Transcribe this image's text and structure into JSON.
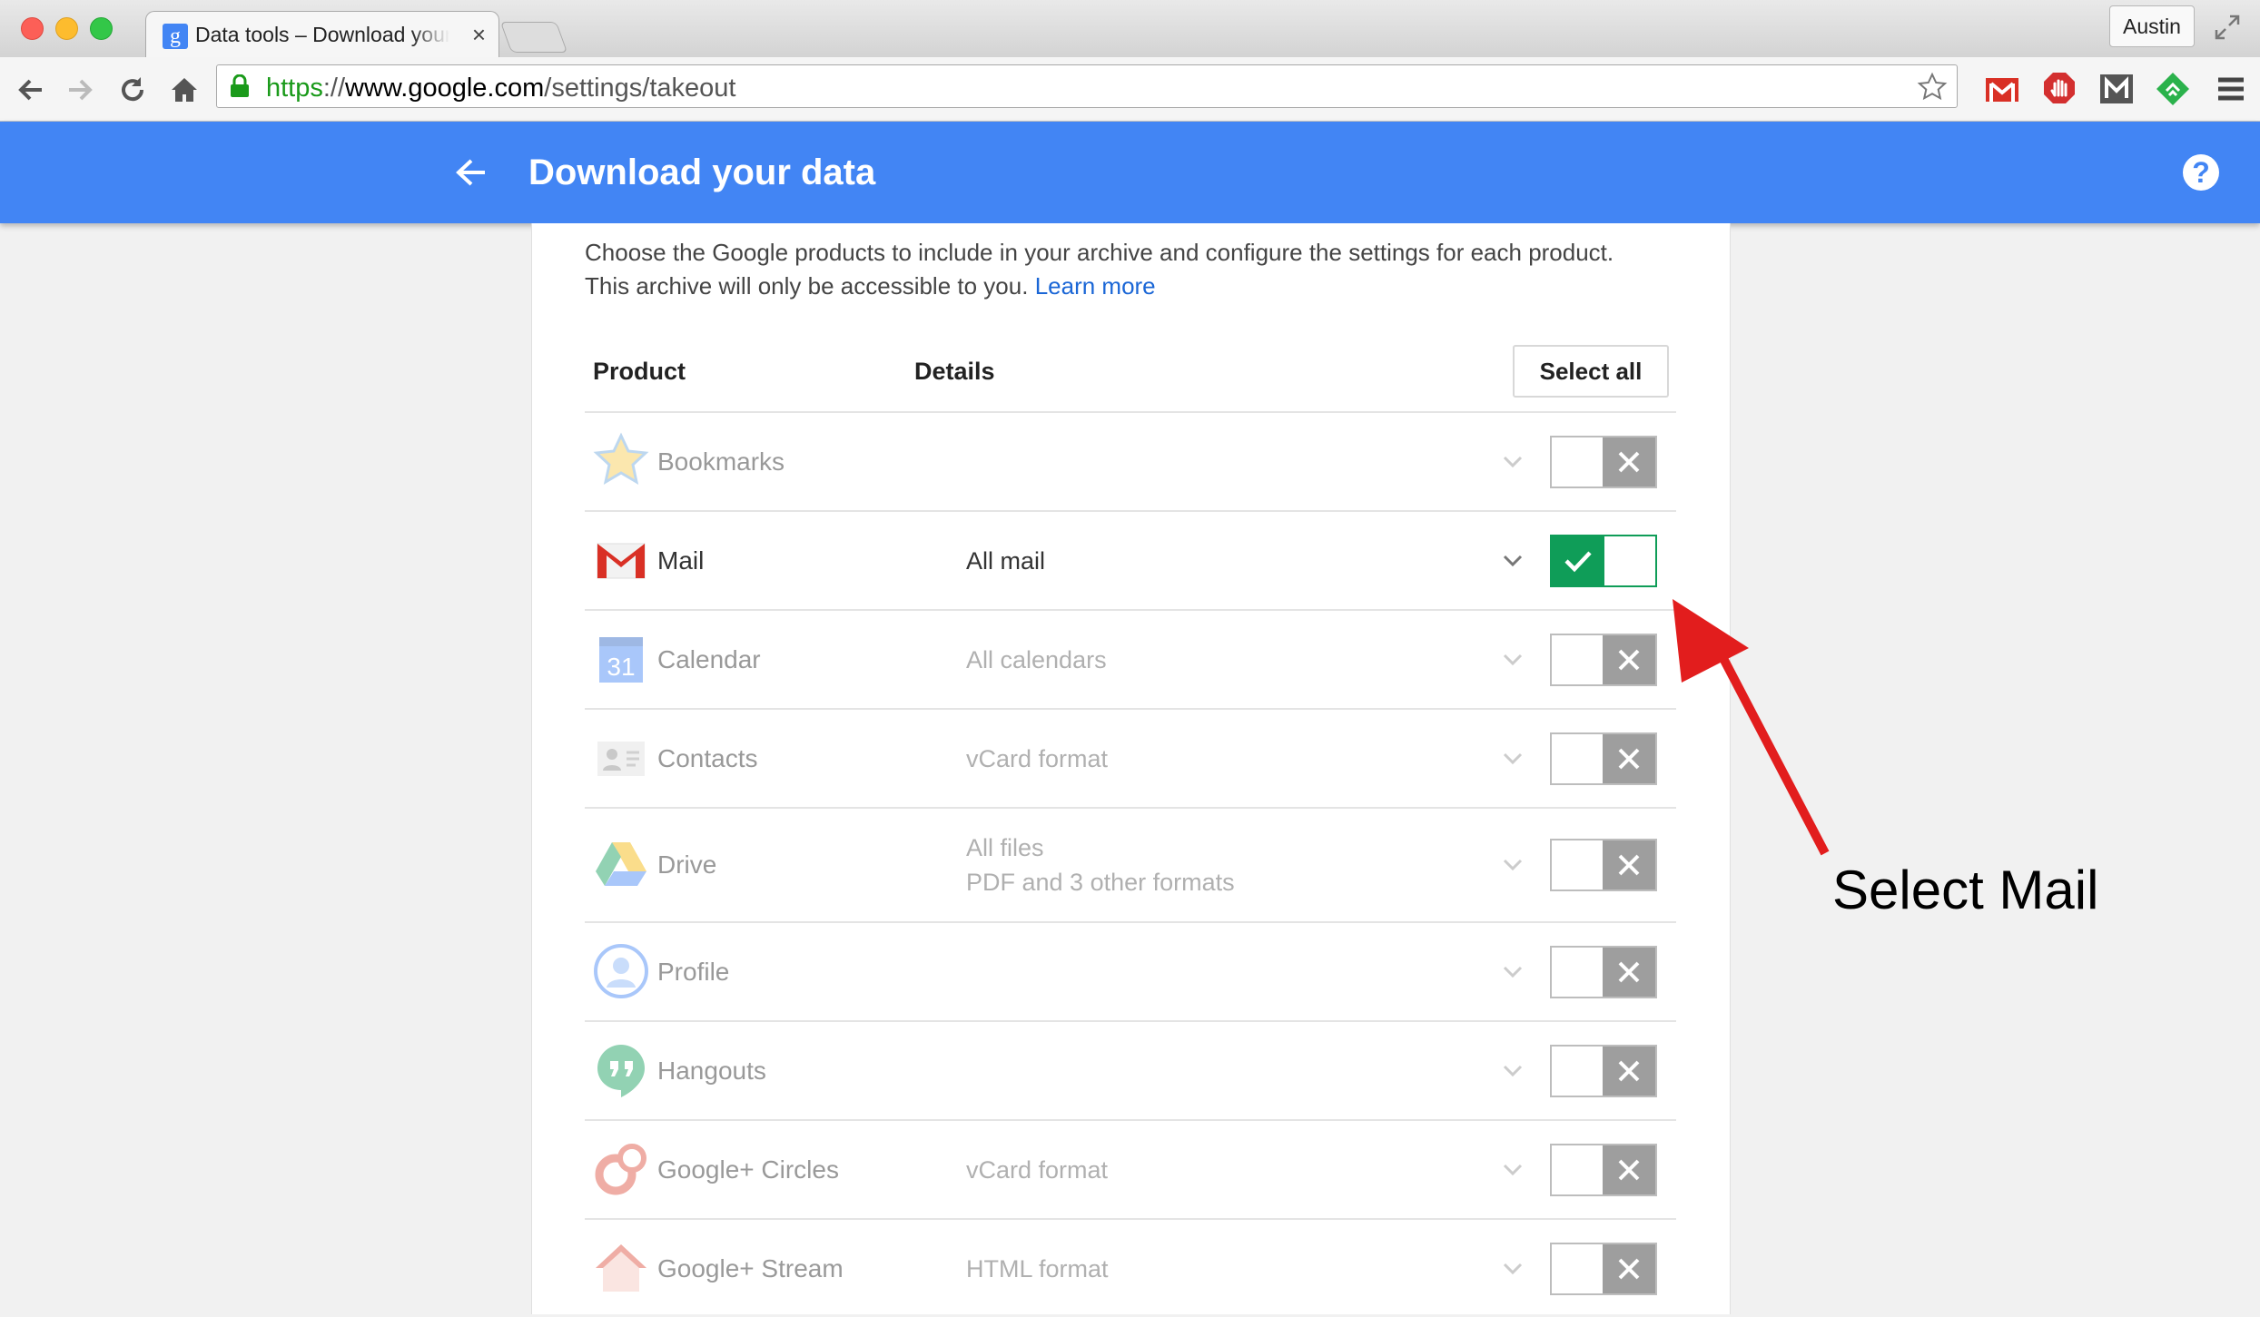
{
  "browser": {
    "tab_title": "Data tools – Download your data",
    "tab_close": "×",
    "favicon_letter": "g",
    "profile_name": "Austin",
    "url": {
      "scheme": "https",
      "sep": "://",
      "host": "www.google.com",
      "path": "/settings/takeout"
    }
  },
  "header": {
    "title": "Download your data",
    "help": "?"
  },
  "intro": {
    "line1": "Choose the Google products to include in your archive and configure the settings for each product.",
    "line2": "This archive will only be accessible to you.",
    "learn_more": "Learn more"
  },
  "columns": {
    "product": "Product",
    "details": "Details",
    "select_all": "Select all"
  },
  "products": [
    {
      "name": "Bookmarks",
      "details": "",
      "details2": "",
      "selected": false,
      "icon": "star-icon"
    },
    {
      "name": "Mail",
      "details": "All mail",
      "details2": "",
      "selected": true,
      "icon": "gmail-icon"
    },
    {
      "name": "Calendar",
      "details": "All calendars",
      "details2": "",
      "selected": false,
      "icon": "calendar-icon",
      "icon_text": "31"
    },
    {
      "name": "Contacts",
      "details": "vCard format",
      "details2": "",
      "selected": false,
      "icon": "contacts-icon"
    },
    {
      "name": "Drive",
      "details": "All files",
      "details2": "PDF and 3 other formats",
      "selected": false,
      "icon": "drive-icon"
    },
    {
      "name": "Profile",
      "details": "",
      "details2": "",
      "selected": false,
      "icon": "profile-icon"
    },
    {
      "name": "Hangouts",
      "details": "",
      "details2": "",
      "selected": false,
      "icon": "hangouts-icon"
    },
    {
      "name": "Google+ Circles",
      "details": "vCard format",
      "details2": "",
      "selected": false,
      "icon": "circles-icon"
    },
    {
      "name": "Google+ Stream",
      "details": "HTML format",
      "details2": "",
      "selected": false,
      "icon": "stream-icon"
    }
  ],
  "annotation": {
    "text": "Select Mail",
    "color": "#e21d1d"
  },
  "colors": {
    "appbar": "#4285f4",
    "toggle_on": "#0f9d58",
    "toggle_off": "#9e9e9e",
    "link": "#1a66d6"
  }
}
